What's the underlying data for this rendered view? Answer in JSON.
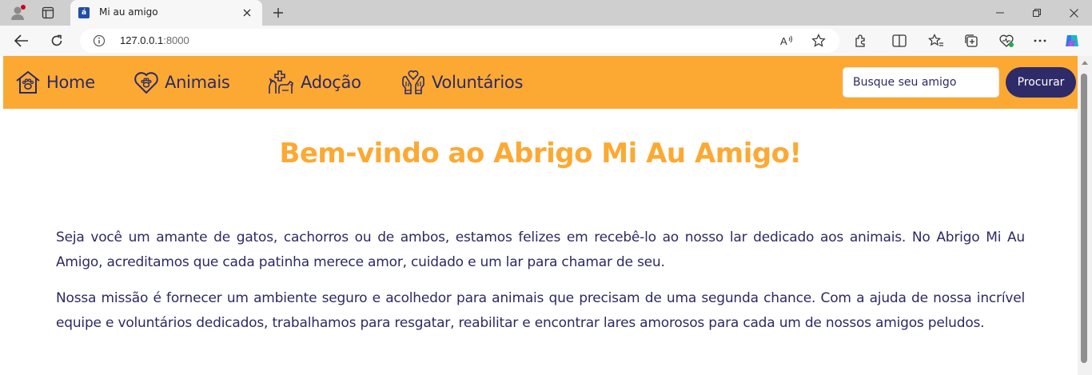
{
  "browser": {
    "tab_title": "Mi au amigo",
    "tab_favicon": "á",
    "url_host": "127.0.0.1",
    "url_port": ":8000",
    "new_tab_label": "+"
  },
  "site": {
    "nav": [
      {
        "label": "Home",
        "icon": "house-paw-icon"
      },
      {
        "label": "Animais",
        "icon": "heart-paw-icon"
      },
      {
        "label": "Adoção",
        "icon": "pets-cross-icon"
      },
      {
        "label": "Voluntários",
        "icon": "hands-heart-icon"
      }
    ],
    "search_placeholder": "Busque seu amigo",
    "search_button": "Procurar"
  },
  "main": {
    "title": "Bem-vindo ao Abrigo Mi Au Amigo!",
    "paragraphs": [
      "Seja você um amante de gatos, cachorros ou de ambos, estamos felizes em recebê-lo ao nosso lar dedicado aos animais. No Abrigo Mi Au Amigo, acreditamos que cada patinha merece amor, cuidado e um lar para chamar de seu.",
      "Nossa missão é fornecer um ambiente seguro e acolhedor para animais que precisam de uma segunda chance. Com a ajuda de nossa incrível equipe e voluntários dedicados, trabalhamos para resgatar, reabilitar e encontrar lares amorosos para cada um de nossos amigos peludos."
    ]
  },
  "colors": {
    "nav_bg": "#fca934",
    "nav_text": "#2d2a63",
    "title": "#fca934",
    "body_text": "#2d2a63",
    "button_bg": "#2f2a68"
  }
}
